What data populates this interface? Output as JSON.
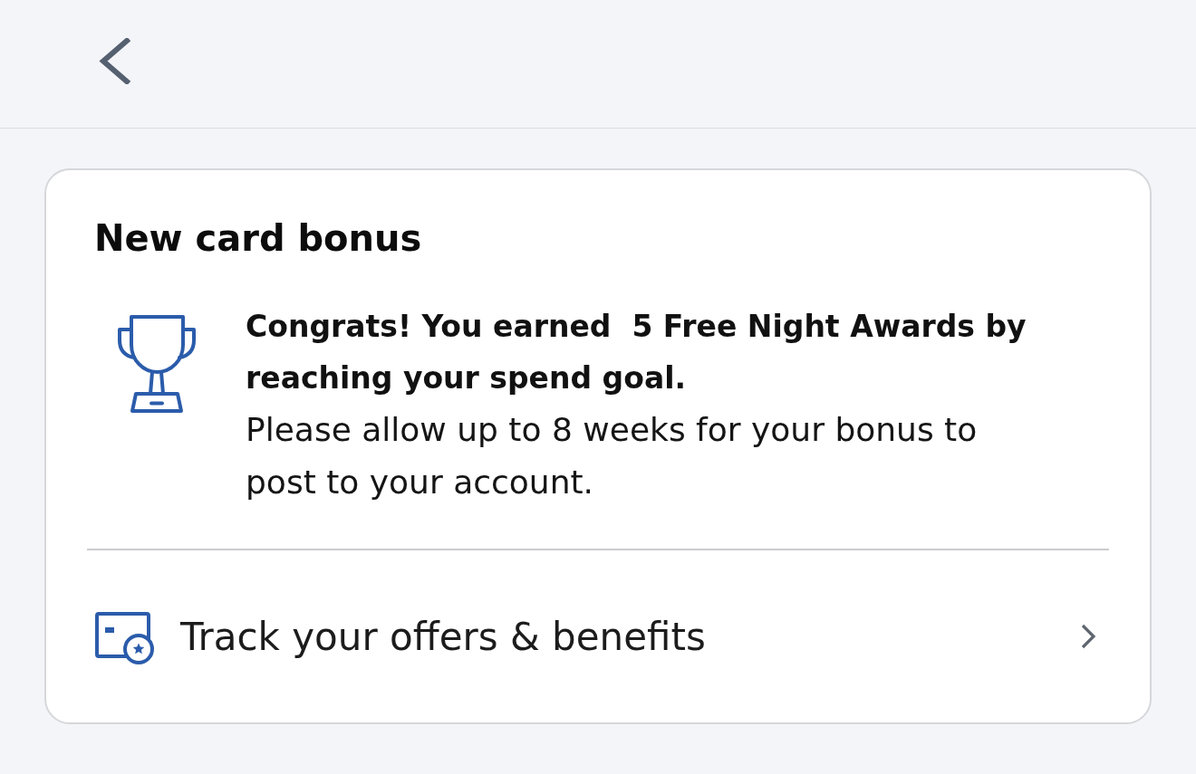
{
  "card": {
    "title": "New card bonus",
    "message": {
      "headline": "Congrats! You earned  5 Free Night Awards by reaching your spend goal.",
      "body": "Please allow up to 8 weeks for your bonus to post to your account."
    },
    "link": {
      "label": "Track your offers & benefits"
    }
  }
}
